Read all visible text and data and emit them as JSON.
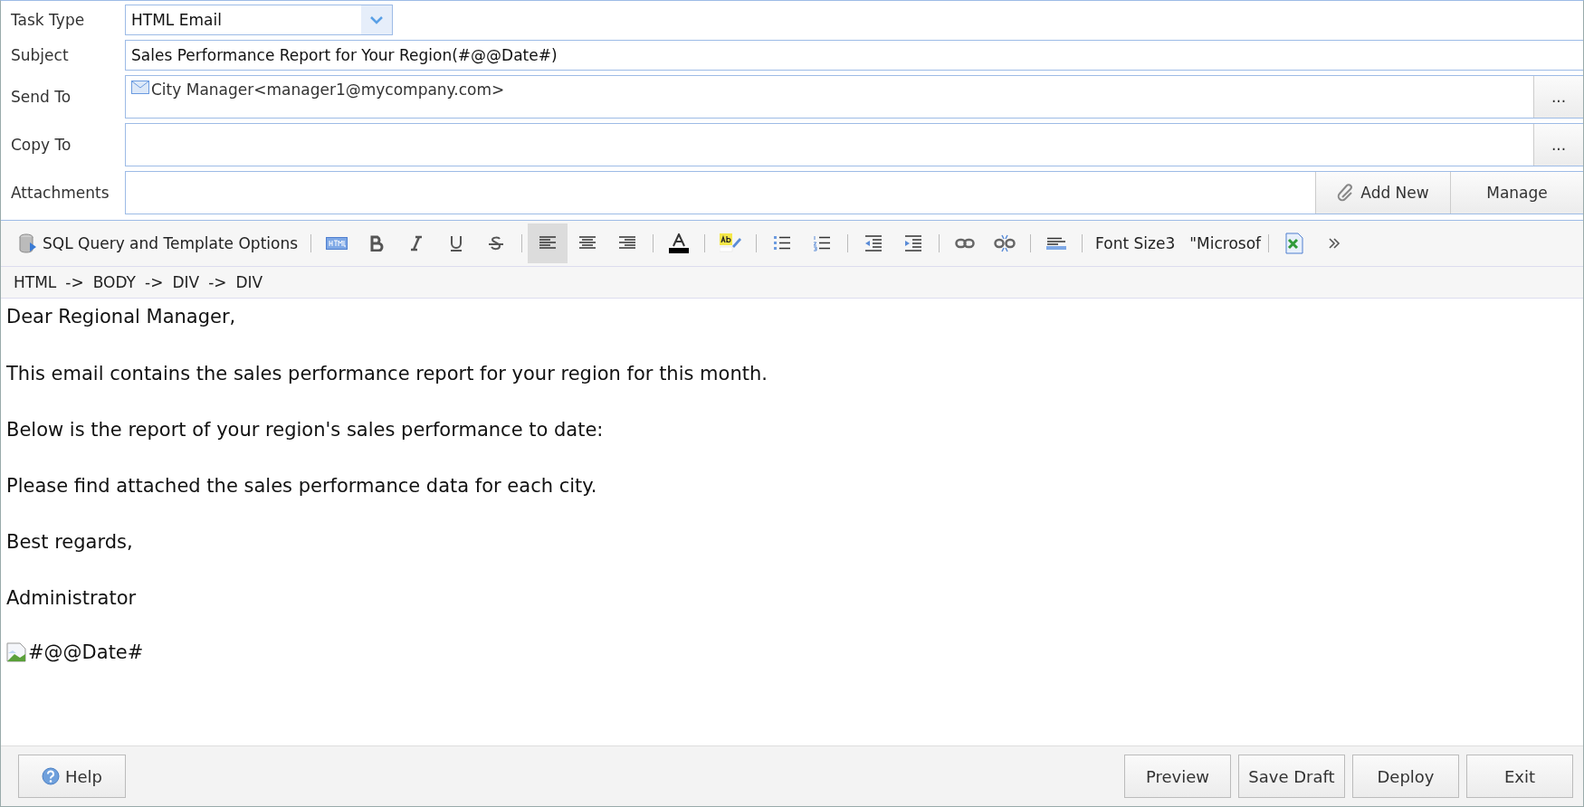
{
  "form": {
    "task_type": {
      "label": "Task Type",
      "value": "HTML Email"
    },
    "subject": {
      "label": "Subject",
      "value": "Sales Performance Report for Your Region(#@@Date#)"
    },
    "send_to": {
      "label": "Send To",
      "recipients": [
        "City Manager<manager1@mycompany.com>"
      ],
      "button": "..."
    },
    "copy_to": {
      "label": "Copy To",
      "button": "..."
    },
    "attachments": {
      "label": "Attachments",
      "buttons": [
        "Add New",
        "Manage"
      ]
    }
  },
  "toolbar": {
    "sql_button": "SQL Query and Template Options",
    "align_buttons": [
      {
        "selected": true
      },
      {
        "selected": false
      },
      {
        "selected": false
      }
    ],
    "font_size": "Font Size3",
    "font_name": "\"Microsof"
  },
  "breadcrumb": [
    "HTML",
    "BODY",
    "DIV",
    "DIV"
  ],
  "breadcrumb_separator": "->",
  "body": {
    "paragraphs": [
      "Dear Regional Manager,",
      "This email contains the sales performance report for your region for this month.",
      "Below is the report of your region's sales performance to date:",
      "Please find attached the sales performance data for each city.",
      "Best regards,",
      "Administrator"
    ],
    "image_alt": "#@@Date#"
  },
  "footer": {
    "help": "Help",
    "buttons": [
      "Preview",
      "Save Draft",
      "Deploy",
      "Exit"
    ]
  }
}
